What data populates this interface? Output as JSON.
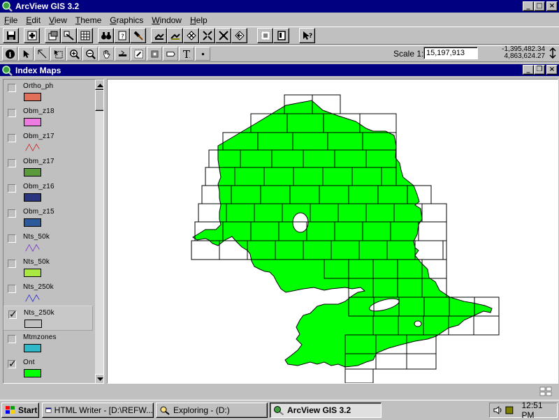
{
  "app": {
    "title": "ArcView GIS 3.2",
    "menu": [
      {
        "label": "File",
        "u": "F",
        "rest": "ile"
      },
      {
        "label": "Edit",
        "u": "E",
        "rest": "dit"
      },
      {
        "label": "View",
        "u": "V",
        "rest": "iew"
      },
      {
        "label": "Theme",
        "u": "T",
        "rest": "heme"
      },
      {
        "label": "Graphics",
        "u": "G",
        "rest": "raphics"
      },
      {
        "label": "Window",
        "u": "W",
        "rest": "indow"
      },
      {
        "label": "Help",
        "u": "H",
        "rest": "elp"
      }
    ],
    "scale_label": "Scale 1:",
    "scale_value": "15,197,913",
    "coord_x": "-1,395,482.34",
    "coord_y": "4,863,624.27"
  },
  "view_window": {
    "title": "Index Maps",
    "themes": [
      {
        "name": "Ortho_ph",
        "checked": false,
        "symbol": "fill",
        "color": "#e0705a"
      },
      {
        "name": "Obm_z18",
        "checked": false,
        "symbol": "fill",
        "color": "#ee7ce0"
      },
      {
        "name": "Obm_z17",
        "checked": false,
        "symbol": "line",
        "color": "#cc2222"
      },
      {
        "name": "Obm_z17",
        "checked": false,
        "symbol": "fill",
        "color": "#5a9a3a"
      },
      {
        "name": "Obm_z16",
        "checked": false,
        "symbol": "fill",
        "color": "#2a3580"
      },
      {
        "name": "Obm_z15",
        "checked": false,
        "symbol": "fill",
        "color": "#2a5a9a"
      },
      {
        "name": "Nts_50k",
        "checked": false,
        "symbol": "line",
        "color": "#7a30c8"
      },
      {
        "name": "Nts_50k",
        "checked": false,
        "symbol": "fill",
        "color": "#a8e840"
      },
      {
        "name": "Nts_250k",
        "checked": false,
        "symbol": "line",
        "color": "#2a2ad0"
      },
      {
        "name": "Nts_250k",
        "checked": true,
        "symbol": "fill",
        "color": "#c0c0c0",
        "active": true
      },
      {
        "name": "Mtmzones",
        "checked": false,
        "symbol": "fill",
        "color": "#30b8c8"
      },
      {
        "name": "Ont",
        "checked": true,
        "symbol": "fill",
        "color": "#00ff00"
      }
    ],
    "map_fill": "#00ff00"
  },
  "taskbar": {
    "start": "Start",
    "tasks": [
      {
        "label": "HTML Writer - [D:\\REFW...",
        "active": false
      },
      {
        "label": "Exploring - (D:)",
        "active": false
      },
      {
        "label": "ArcView GIS 3.2",
        "active": true
      }
    ],
    "clock": "12:51 PM"
  }
}
